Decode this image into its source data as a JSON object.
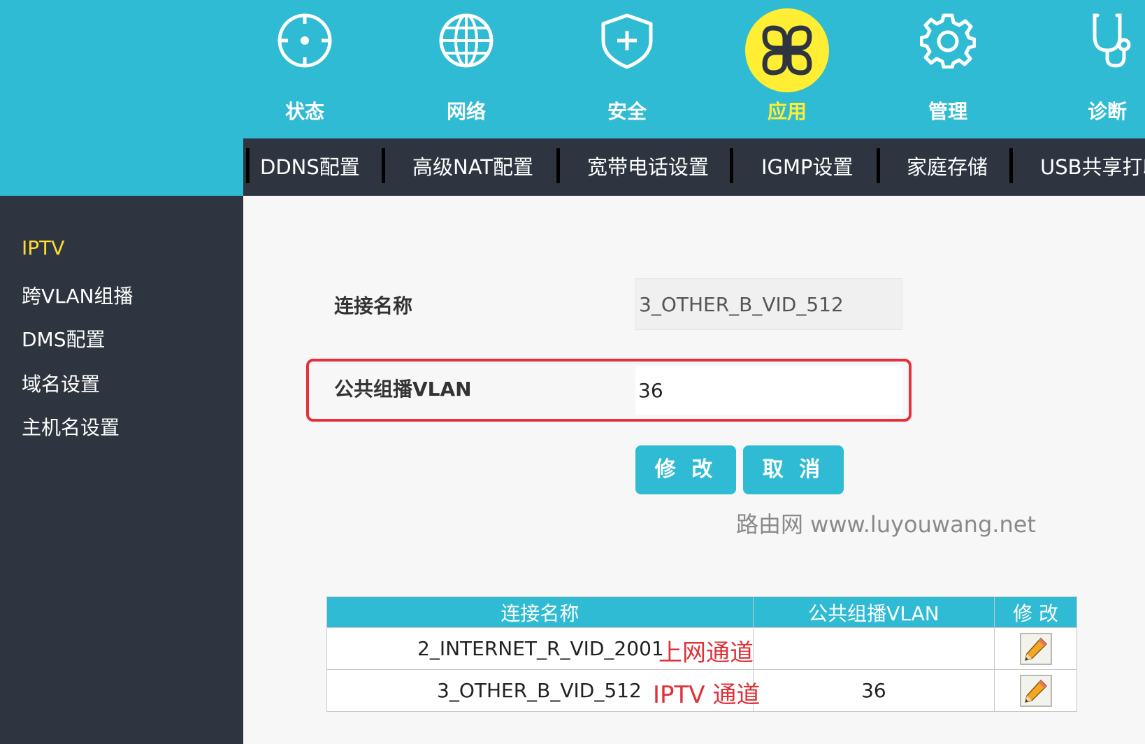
{
  "nav": {
    "items": [
      {
        "label": "状态",
        "icon": "crosshair-icon"
      },
      {
        "label": "网络",
        "icon": "globe-icon"
      },
      {
        "label": "安全",
        "icon": "shield-plus-icon"
      },
      {
        "label": "应用",
        "icon": "apps-icon",
        "active": true
      },
      {
        "label": "管理",
        "icon": "gear-icon"
      },
      {
        "label": "诊断",
        "icon": "stethoscope-icon"
      }
    ]
  },
  "subnav": {
    "items": [
      "DDNS配置",
      "高级NAT配置",
      "宽带电话设置",
      "IGMP设置",
      "家庭存储",
      "USB共享打印"
    ]
  },
  "sidebar": {
    "items": [
      "IPTV",
      "跨VLAN组播",
      "DMS配置",
      "域名设置",
      "主机名设置"
    ],
    "active_index": 0
  },
  "form": {
    "connection_label": "连接名称",
    "connection_value": "3_OTHER_B_VID_512",
    "vlan_label": "公共组播VLAN",
    "vlan_value": "36",
    "modify_button": "修 改",
    "cancel_button": "取 消"
  },
  "watermark": "路由网 www.luyouwang.net",
  "table": {
    "headers": [
      "连接名称",
      "公共组播VLAN",
      "修 改"
    ],
    "rows": [
      {
        "name": "2_INTERNET_R_VID_2001",
        "note": "上网通道",
        "vlan": ""
      },
      {
        "name": "3_OTHER_B_VID_512",
        "note": "IPTV 通道",
        "vlan": "36"
      }
    ]
  },
  "colors": {
    "header_bg": "#2fbbd3",
    "dark_bg": "#2e3540",
    "active_yellow": "#ffee33",
    "highlight_red": "#e8303a",
    "annotation_red": "#e03038"
  }
}
